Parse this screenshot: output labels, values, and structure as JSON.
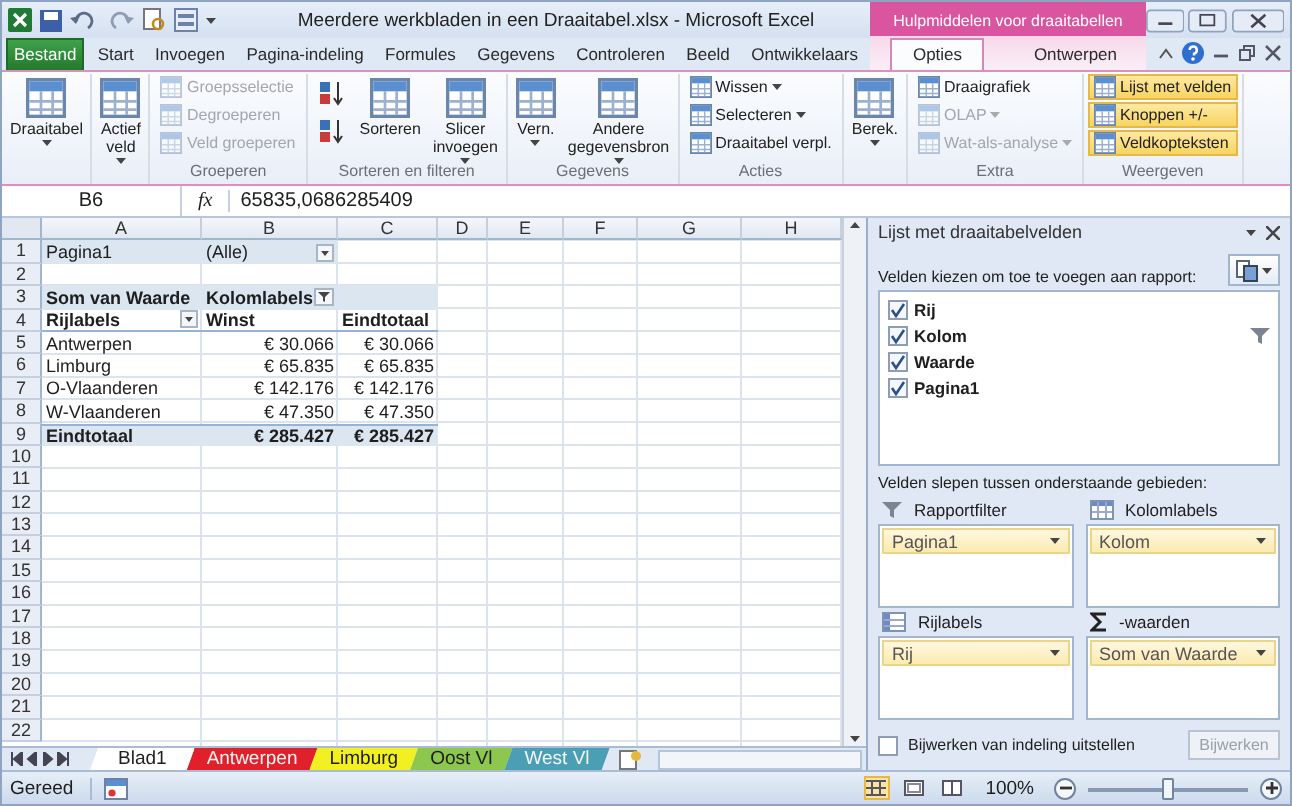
{
  "title_bar": {
    "title": "Meerdere werkbladen in een Draaitabel.xlsx - Microsoft Excel",
    "context_label": "Hulpmiddelen voor draaitabellen"
  },
  "ribbon_tabs": [
    {
      "label": "Bestand",
      "kind": "file",
      "selected": false
    },
    {
      "label": "Start",
      "kind": "tab",
      "selected": false
    },
    {
      "label": "Invoegen",
      "kind": "tab",
      "selected": false
    },
    {
      "label": "Pagina-indeling",
      "kind": "tab",
      "selected": false
    },
    {
      "label": "Formules",
      "kind": "tab",
      "selected": false
    },
    {
      "label": "Gegevens",
      "kind": "tab",
      "selected": false
    },
    {
      "label": "Controleren",
      "kind": "tab",
      "selected": false
    },
    {
      "label": "Beeld",
      "kind": "tab",
      "selected": false
    },
    {
      "label": "Ontwikkelaars",
      "kind": "tab",
      "selected": false
    },
    {
      "label": "Opties",
      "kind": "context",
      "selected": true
    },
    {
      "label": "Ontwerpen",
      "kind": "context",
      "selected": false
    }
  ],
  "ribbon_groups": [
    {
      "items": [
        {
          "label": "Draaitabel",
          "kind": "large",
          "caret": true,
          "disabled": false,
          "on": false
        }
      ]
    },
    {
      "items": [
        {
          "label": "Actief veld",
          "kind": "large",
          "caret": true,
          "disabled": false,
          "on": false
        }
      ]
    },
    {
      "label": "Groeperen",
      "items": [
        {
          "label": "Groepsselectie",
          "kind": "small",
          "caret": false,
          "disabled": true,
          "on": false
        },
        {
          "label": "Degroeperen",
          "kind": "small",
          "caret": false,
          "disabled": true,
          "on": false
        },
        {
          "label": "Veld groeperen",
          "kind": "small",
          "caret": false,
          "disabled": true,
          "on": false
        }
      ]
    },
    {
      "label": "Sorteren en filteren",
      "items": [
        {
          "kind": "sort",
          "caret": false,
          "disabled": false,
          "on": false
        },
        {
          "kind": "sort",
          "caret": false,
          "disabled": false,
          "on": false
        },
        {
          "label": "Sorteren",
          "kind": "large",
          "caret": false,
          "disabled": false,
          "on": false
        },
        {
          "label": "Slicer invoegen",
          "kind": "large",
          "caret": true,
          "disabled": false,
          "on": false
        }
      ]
    },
    {
      "label": "Gegevens",
      "items": [
        {
          "label": "Vern.",
          "kind": "large",
          "caret": true,
          "disabled": false,
          "on": false
        },
        {
          "label": "Andere gegevensbron",
          "kind": "large",
          "caret": true,
          "disabled": false,
          "on": false
        }
      ]
    },
    {
      "label": "Acties",
      "items": [
        {
          "label": "Wissen",
          "kind": "small",
          "caret": true,
          "disabled": false,
          "on": false
        },
        {
          "label": "Selecteren",
          "kind": "small",
          "caret": true,
          "disabled": false,
          "on": false
        },
        {
          "label": "Draaitabel verpl.",
          "kind": "small",
          "caret": false,
          "disabled": false,
          "on": false
        }
      ]
    },
    {
      "items": [
        {
          "label": "Berek.",
          "kind": "large",
          "caret": true,
          "disabled": false,
          "on": false
        }
      ]
    },
    {
      "label": "Extra",
      "items": [
        {
          "label": "Draaigrafiek",
          "kind": "small",
          "caret": false,
          "disabled": false,
          "on": false
        },
        {
          "label": "OLAP",
          "kind": "small",
          "caret": true,
          "disabled": true,
          "on": false
        },
        {
          "label": "Wat-als-analyse",
          "kind": "small",
          "caret": true,
          "disabled": true,
          "on": false
        }
      ]
    },
    {
      "label": "Weergeven",
      "items": [
        {
          "label": "Lijst met velden",
          "kind": "small",
          "caret": false,
          "disabled": false,
          "on": true
        },
        {
          "label": "Knoppen +/-",
          "kind": "small",
          "caret": false,
          "disabled": false,
          "on": true
        },
        {
          "label": "Veldkopteksten",
          "kind": "small",
          "caret": false,
          "disabled": false,
          "on": true
        }
      ]
    }
  ],
  "formula_bar": {
    "name_box": "B6",
    "function_label": "fx",
    "value": "65835,0686285409"
  },
  "grid": {
    "columns": [
      "A",
      "B",
      "C",
      "D",
      "E",
      "F",
      "G",
      "H"
    ],
    "rows": [
      {
        "number": "1",
        "kind": "page",
        "cells": [
          "Pagina1",
          "(Alle)"
        ]
      },
      {
        "number": "2",
        "kind": "blank",
        "cells": []
      },
      {
        "number": "3",
        "kind": "corner",
        "cells": [
          "Som van Waarde",
          "Kolomlabels"
        ]
      },
      {
        "number": "4",
        "kind": "header",
        "cells": [
          "Rijlabels",
          "Winst",
          "Eindtotaal"
        ]
      },
      {
        "number": "5",
        "kind": "item",
        "cells": [
          "Antwerpen",
          "€ 30.066",
          "€ 30.066"
        ]
      },
      {
        "number": "6",
        "kind": "item",
        "cells": [
          "Limburg",
          "€ 65.835",
          "€ 65.835"
        ]
      },
      {
        "number": "7",
        "kind": "item",
        "cells": [
          "O-Vlaanderen",
          "€ 142.176",
          "€ 142.176"
        ]
      },
      {
        "number": "8",
        "kind": "item",
        "cells": [
          "W-Vlaanderen",
          "€ 47.350",
          "€ 47.350"
        ]
      },
      {
        "number": "9",
        "kind": "total",
        "cells": [
          "Eindtotaal",
          "€ 285.427",
          "€ 285.427"
        ]
      },
      {
        "number": "10",
        "kind": "blank",
        "cells": []
      },
      {
        "number": "11",
        "kind": "blank",
        "cells": []
      },
      {
        "number": "12",
        "kind": "blank",
        "cells": []
      },
      {
        "number": "13",
        "kind": "blank",
        "cells": []
      },
      {
        "number": "14",
        "kind": "blank",
        "cells": []
      },
      {
        "number": "15",
        "kind": "blank",
        "cells": []
      },
      {
        "number": "16",
        "kind": "blank",
        "cells": []
      },
      {
        "number": "17",
        "kind": "blank",
        "cells": []
      },
      {
        "number": "18",
        "kind": "blank",
        "cells": []
      },
      {
        "number": "19",
        "kind": "blank",
        "cells": []
      },
      {
        "number": "20",
        "kind": "blank",
        "cells": []
      },
      {
        "number": "21",
        "kind": "blank",
        "cells": []
      },
      {
        "number": "22",
        "kind": "blank",
        "cells": []
      }
    ]
  },
  "field_list": {
    "title": "Lijst met draaitabelvelden",
    "choose_label": "Velden kiezen om toe te voegen aan rapport:",
    "fields": [
      {
        "name": "Rij",
        "checked": true,
        "filtered": false
      },
      {
        "name": "Kolom",
        "checked": true,
        "filtered": true
      },
      {
        "name": "Waarde",
        "checked": true,
        "filtered": false
      },
      {
        "name": "Pagina1",
        "checked": true,
        "filtered": false
      }
    ],
    "drag_label": "Velden slepen tussen onderstaande gebieden:",
    "areas": [
      {
        "kind": "filter",
        "label": "Rapportfilter",
        "items": [
          "Pagina1"
        ]
      },
      {
        "kind": "columns",
        "label": "Kolomlabels",
        "items": [
          "Kolom"
        ]
      },
      {
        "kind": "rows",
        "label": "Rijlabels",
        "items": [
          "Rij"
        ]
      },
      {
        "kind": "values",
        "label": "-waarden",
        "items": [
          "Som van Waarde"
        ]
      }
    ],
    "defer": {
      "label": "Bijwerken van indeling uitstellen",
      "checked": false
    },
    "update_button": {
      "label": "Bijwerken",
      "disabled": true
    }
  },
  "sheet_tabs": [
    {
      "label": "Blad1",
      "selected": true,
      "color": "#ffffff"
    },
    {
      "label": "Antwerpen",
      "selected": false,
      "color": "#e0202a"
    },
    {
      "label": "Limburg",
      "selected": false,
      "color": "#f2f020"
    },
    {
      "label": "Oost Vl",
      "selected": false,
      "color": "#8cc84e"
    },
    {
      "label": "West Vl",
      "selected": false,
      "color": "#4b9fb4"
    }
  ],
  "status_bar": {
    "status": "Gereed",
    "zoom": "100%",
    "zoom_slider": {
      "level": 0.5
    }
  }
}
